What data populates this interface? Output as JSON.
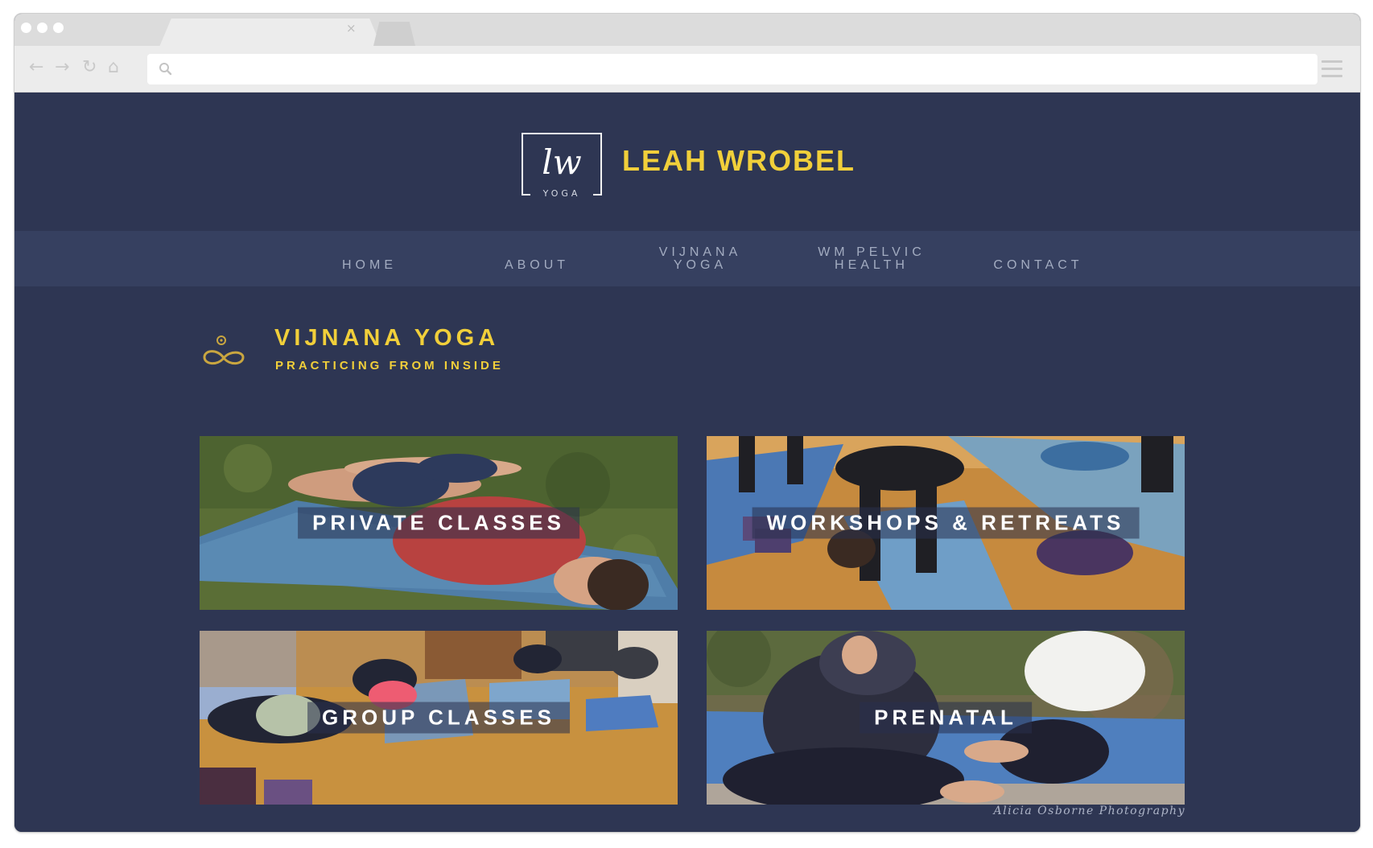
{
  "browser": {
    "url": "",
    "tab_close_glyph": "×",
    "back_glyph": "←",
    "forward_glyph": "→",
    "reload_glyph": "↻",
    "home_glyph": "⌂"
  },
  "header": {
    "logo_monogram": "lw",
    "logo_word": "YOGA",
    "brand_name": "LEAH WROBEL"
  },
  "nav": {
    "items": [
      {
        "label": "HOME"
      },
      {
        "label": "ABOUT"
      },
      {
        "label": "VIJNANA YOGA"
      },
      {
        "label": "WM PELVIC HEALTH"
      },
      {
        "label": "CONTACT"
      }
    ]
  },
  "section": {
    "title": "VIJNANA YOGA",
    "subtitle": "PRACTICING FROM INSIDE",
    "icon": "infinity-meditation-icon"
  },
  "cards": [
    {
      "label": "PRIVATE CLASSES",
      "photo": "man-reclining-on-mat-photo"
    },
    {
      "label": "WORKSHOPS & RETREATS",
      "photo": "group-forward-fold-photo"
    },
    {
      "label": "GROUP CLASSES",
      "photo": "downward-dog-class-photo"
    },
    {
      "label": "PRENATAL",
      "photo": "prenatal-assist-photo"
    }
  ],
  "credit": "Alicia Osborne Photography",
  "colors": {
    "page_bg": "#2e3653",
    "nav_bg": "#364060",
    "accent_yellow": "#f1cf3a",
    "nav_text": "#a3acc1"
  }
}
